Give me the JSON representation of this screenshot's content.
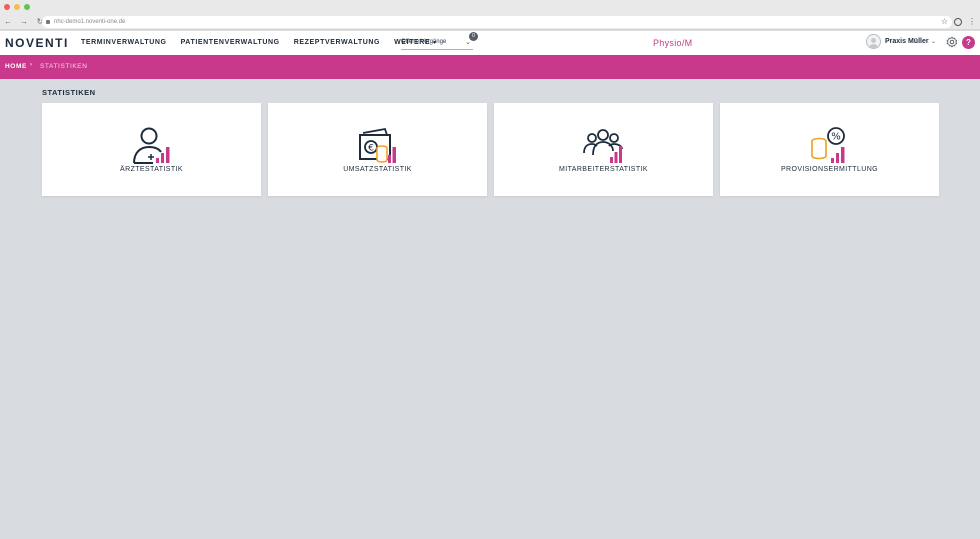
{
  "browser": {
    "url": "nhc-demo1.noventi-one.de"
  },
  "header": {
    "logo_text": "NOVENTI",
    "nav": [
      {
        "label": "TERMINVERWALTUNG"
      },
      {
        "label": "PATIENTENVERWALTUNG"
      },
      {
        "label": "REZEPTVERWALTUNG"
      },
      {
        "label": "WEITERE"
      }
    ],
    "dropdown_value": "Offene Vorgänge",
    "dropdown_badge": "0",
    "brand": "Physio/M",
    "user_name": "Praxis Müller",
    "help_label": "?"
  },
  "breadcrumb": {
    "home": "HOME",
    "separator": "›",
    "current": "STATISTIKEN"
  },
  "page": {
    "title": "STATISTIKEN"
  },
  "cards": [
    {
      "label": "ÄRZTESTATISTIK",
      "icon": "doctor-statistics-icon"
    },
    {
      "label": "UMSATZSTATISTIK",
      "icon": "revenue-statistics-icon"
    },
    {
      "label": "MITARBEITERSTATISTIK",
      "icon": "employee-statistics-icon"
    },
    {
      "label": "PROVISIONSERMITTLUNG",
      "icon": "commission-icon"
    }
  ],
  "colors": {
    "accent": "#c8398c",
    "navy": "#1d2b3c",
    "coin": "#f0a020",
    "background": "#d8dbe0"
  }
}
